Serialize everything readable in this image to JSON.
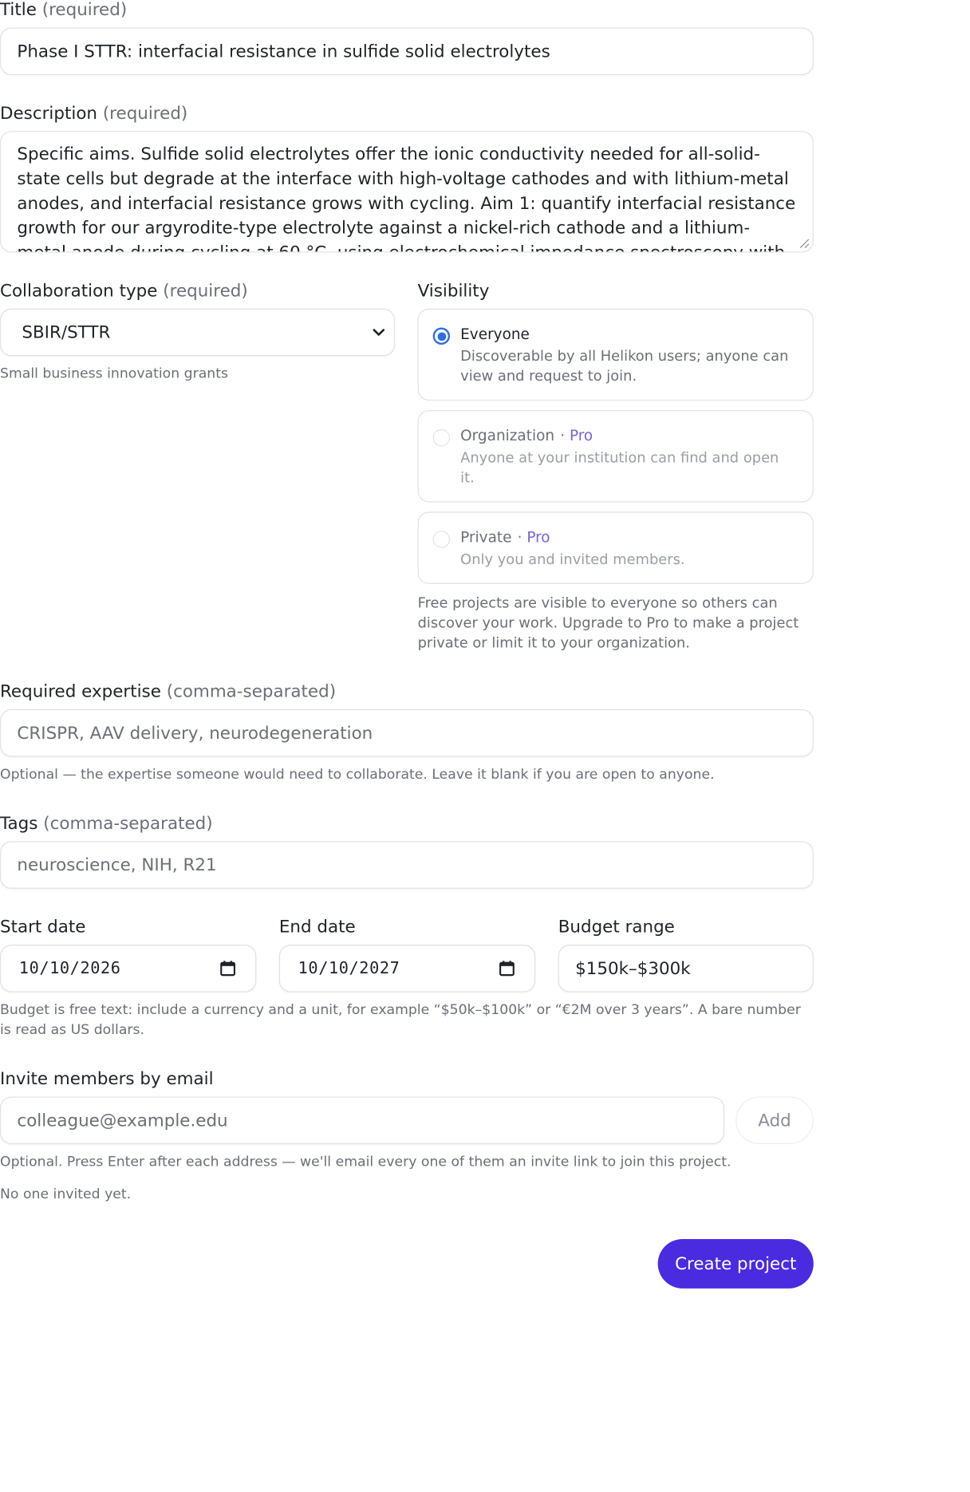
{
  "title_field": {
    "label": "Title",
    "required": "(required)",
    "value": "Phase I STTR: interfacial resistance in sulfide solid electrolytes"
  },
  "description_field": {
    "label": "Description",
    "required": "(required)",
    "value": "Specific aims. Sulfide solid electrolytes offer the ionic conductivity needed for all-solid-state cells but degrade at the interface with high-voltage cathodes and with lithium-metal anodes, and interfacial resistance grows with cycling. Aim 1: quantify interfacial resistance growth for our argyrodite-type electrolyte against a nickel-rich cathode and a lithium-metal anode during cycling at 60 °C, using electrochemical impedance spectroscopy with a distribution of relaxation times"
  },
  "collaboration": {
    "label": "Collaboration type",
    "required": "(required)",
    "selected": "SBIR/STTR",
    "hint": "Small business innovation grants"
  },
  "visibility": {
    "label": "Visibility",
    "options": [
      {
        "title": "Everyone",
        "desc": "Discoverable by all Helikon users; anyone can view and request to join.",
        "pro": ""
      },
      {
        "title": "Organization",
        "desc": "Anyone at your institution can find and open it.",
        "pro": "· Pro"
      },
      {
        "title": "Private",
        "desc": "Only you and invited members.",
        "pro": "· Pro"
      }
    ],
    "selected_index": 0,
    "note": "Free projects are visible to everyone so others can discover your work. Upgrade to Pro to make a project private or limit it to your organization."
  },
  "expertise": {
    "label": "Required expertise",
    "suffix": "(comma-separated)",
    "placeholder": "CRISPR, AAV delivery, neurodegeneration",
    "hint": "Optional — the expertise someone would need to collaborate. Leave it blank if you are open to anyone."
  },
  "tags": {
    "label": "Tags",
    "suffix": "(comma-separated)",
    "placeholder": "neuroscience, NIH, R21"
  },
  "dates": {
    "start_label": "Start date",
    "start_value": "10/10/2026",
    "end_label": "End date",
    "end_value": "10/10/2027",
    "budget_label": "Budget range",
    "budget_value": "$150k–$300k",
    "hint": "Budget is free text: include a currency and a unit, for example “$50k–$100k” or “€2M over 3 years”. A bare number is read as US dollars."
  },
  "invite": {
    "label": "Invite members by email",
    "placeholder": "colleague@example.edu",
    "add_label": "Add",
    "hint": "Optional. Press Enter after each address — we'll email every one of them an invite link to join this project.",
    "empty": "No one invited yet."
  },
  "submit_label": "Create project",
  "colors": {
    "accent": "#4b2be0",
    "radio": "#2f6fe4",
    "pro": "#7b61d6"
  },
  "icons": {
    "select": "chevron-down-icon",
    "date": "calendar-icon"
  }
}
